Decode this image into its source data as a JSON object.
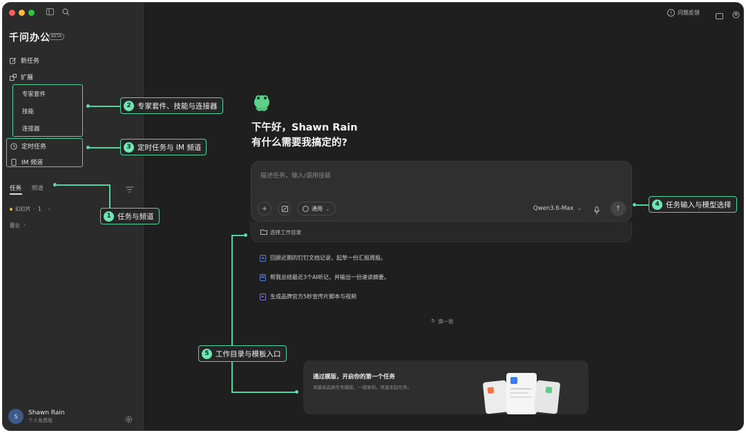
{
  "sidebar": {
    "brand": "千问办公",
    "beta": "BETA",
    "nav": {
      "new_task": "新任务",
      "extensions": "扩展"
    },
    "extension_items": [
      "专家套件",
      "技能",
      "连接器"
    ],
    "scheduled": "定时任务",
    "im_channel": "IM 频道",
    "tabs": {
      "tasks": "任务",
      "channels": "频道"
    },
    "task_item": {
      "label": "幻灯片",
      "count": "1"
    },
    "recent": "最近",
    "user": {
      "initial": "S",
      "name": "Shawn Rain",
      "plan": "个人免费版"
    }
  },
  "topbar": {
    "feedback": "问题反馈"
  },
  "main": {
    "greeting_line1": "下午好，Shawn Rain",
    "greeting_line2": "有什么需要我搞定的?",
    "input_placeholder": "描述任务，输入/调用技能",
    "mode_label": "通用",
    "model": "Qwen3.6-Max",
    "work_dir": "选择工作目录",
    "suggestions": [
      {
        "icon": "doc-icon",
        "text": "回顾近期的钉钉文档记录，起草一份汇报周报。"
      },
      {
        "icon": "ai-note-icon",
        "text": "帮我总结最近3个AI听记，并输出一份速读摘要。"
      },
      {
        "icon": "video-icon",
        "text": "生成品牌官方5秒宣传片脚本与视频"
      }
    ],
    "refresh": "换一批",
    "template_card": {
      "title": "通过模版，开启你的第一个任务",
      "desc": "海量高品质任务模版，一键复刻，快速发起任务。"
    }
  },
  "callouts": [
    {
      "num": "1",
      "text": "任务与频道"
    },
    {
      "num": "2",
      "text": "专家套件、技能与连接器"
    },
    {
      "num": "3",
      "text": "定时任务与 IM 频道"
    },
    {
      "num": "4",
      "text": "任务输入与模型选择"
    },
    {
      "num": "5",
      "text": "工作目录与模板入口"
    }
  ],
  "colors": {
    "accent": "#4fd6a0",
    "background": "#1f1f1f",
    "sidebar": "#2b2b2b"
  }
}
